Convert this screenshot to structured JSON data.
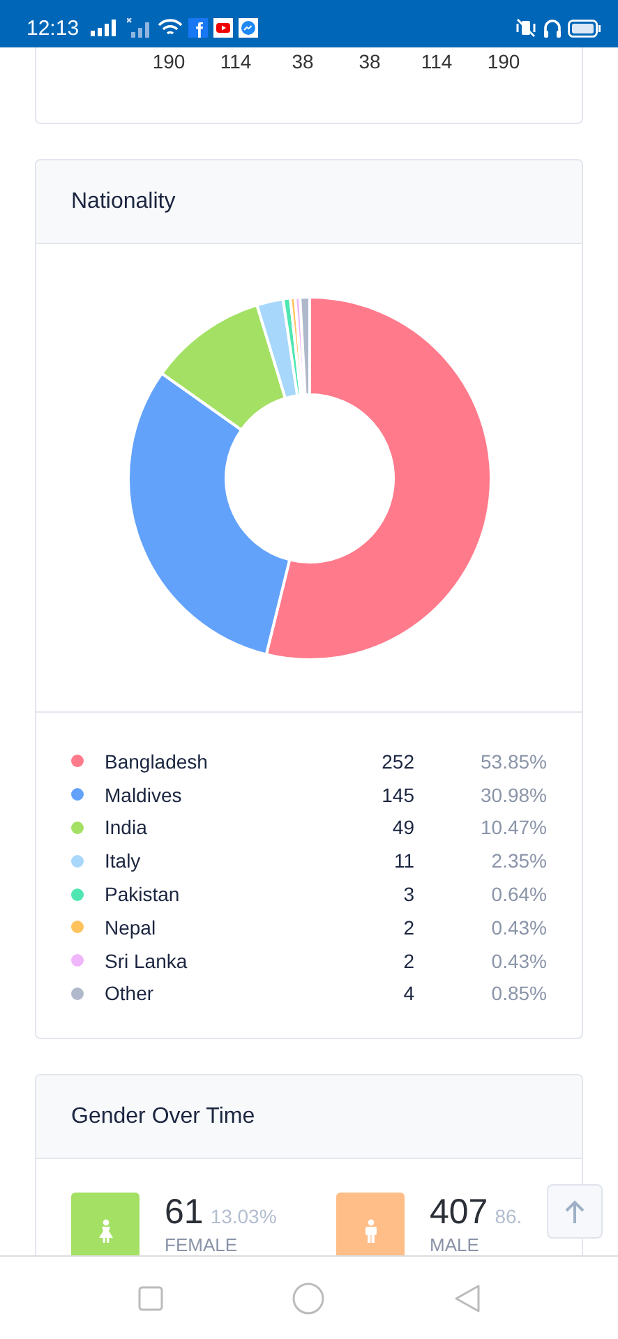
{
  "status_bar": {
    "time": "12:13"
  },
  "top_card": {
    "values": [
      "190",
      "114",
      "38",
      "38",
      "114",
      "190"
    ]
  },
  "nationality": {
    "title": "Nationality",
    "chart_data": {
      "type": "donut",
      "categories": [
        "Bangladesh",
        "Maldives",
        "India",
        "Italy",
        "Pakistan",
        "Nepal",
        "Sri Lanka",
        "Other"
      ],
      "values": [
        53.85,
        30.98,
        10.47,
        2.35,
        0.64,
        0.43,
        0.43,
        0.85
      ]
    },
    "legend": [
      {
        "count": "252",
        "percent": "53.85%",
        "color": "#ff7b8c"
      },
      {
        "count": "145",
        "percent": "30.98%",
        "color": "#62a2fb"
      },
      {
        "count": "49",
        "percent": "10.47%",
        "color": "#a4e063"
      },
      {
        "count": "11",
        "percent": "2.35%",
        "color": "#a7d7fb"
      },
      {
        "count": "3",
        "percent": "0.64%",
        "color": "#4fe6b1"
      },
      {
        "count": "2",
        "percent": "0.43%",
        "color": "#ffc35e"
      },
      {
        "count": "2",
        "percent": "0.43%",
        "color": "#f0b6fa"
      },
      {
        "count": "4",
        "percent": "0.85%",
        "color": "#b0b9cb"
      }
    ]
  },
  "gender": {
    "title": "Gender Over Time",
    "stats": [
      {
        "kind": "female",
        "count": "61",
        "percent": "13.03%",
        "label": "FEMALE",
        "color": "#a4e063"
      },
      {
        "kind": "male",
        "count": "407",
        "percent": "86.",
        "label": "MALE",
        "color": "#ffbd87"
      }
    ]
  }
}
